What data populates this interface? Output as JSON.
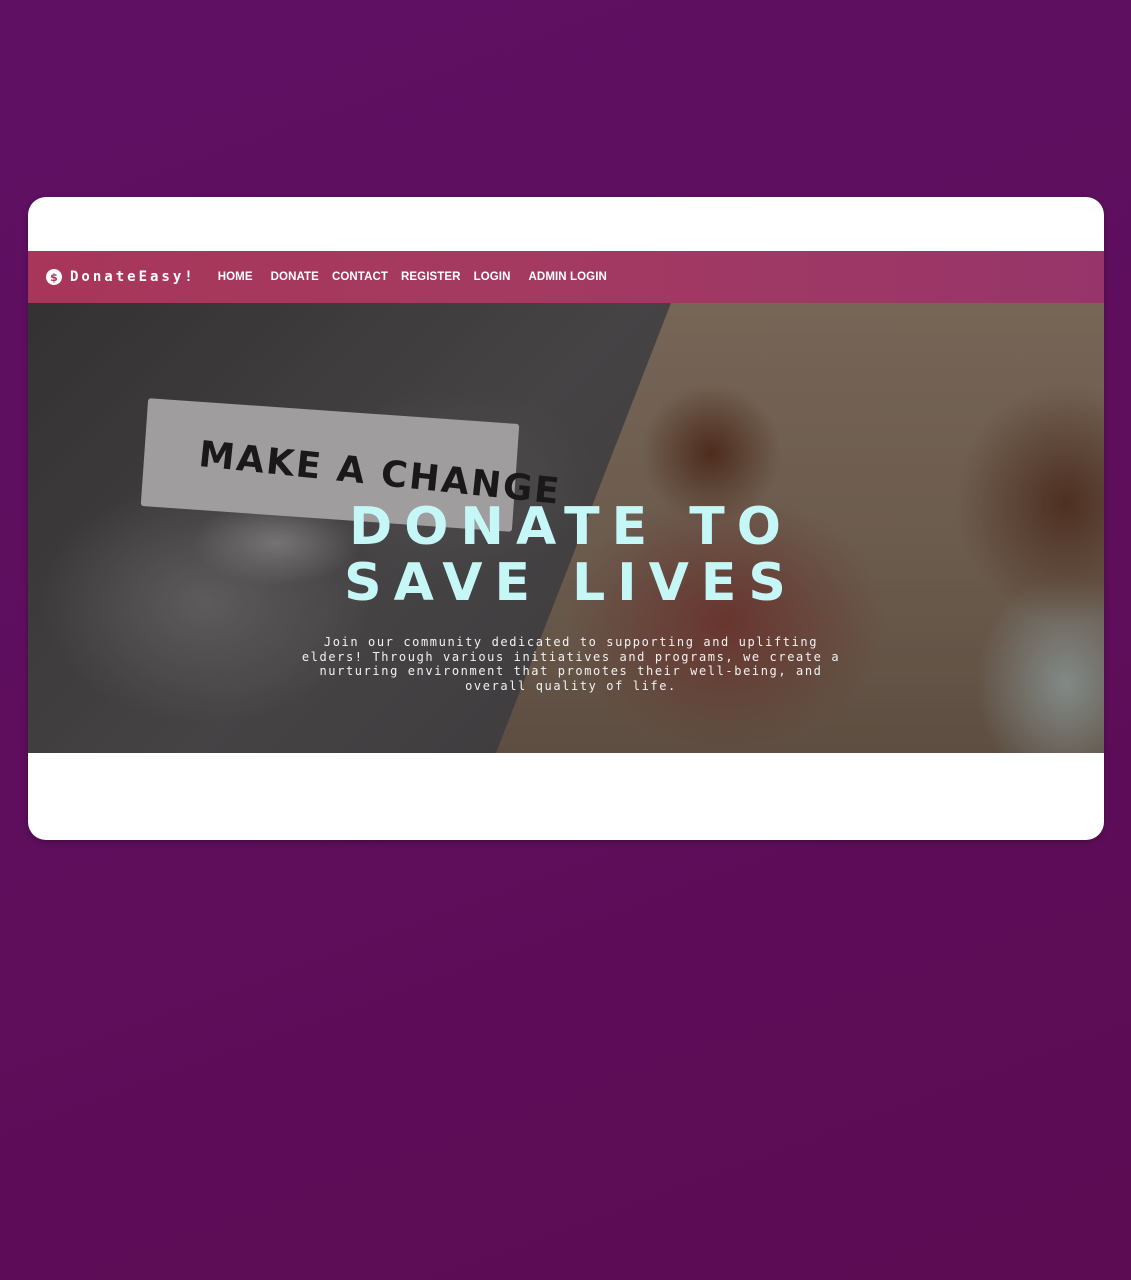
{
  "navbar": {
    "brand": {
      "icon": "dollar-icon",
      "icon_glyph": "$",
      "name": "DonateEasy!"
    },
    "links": {
      "home": "HOME",
      "donate": "DONATE",
      "contact": "CONTACT",
      "register": "REGISTER",
      "login": "LOGIN",
      "admin_login": "ADMIN LOGIN"
    },
    "color": "#a8365a"
  },
  "hero": {
    "image_text": "MAKE A CHANGE",
    "title_line1": "DONATE TO",
    "title_line2": "SAVE LIVES",
    "title_color": "#c6f7f7",
    "description": "Join our community dedicated to supporting and uplifting elders! Through various initiatives and programs, we create a nurturing environment that promotes their well-being, and overall quality of life."
  },
  "colors": {
    "background": "#5e0e5c",
    "card": "#ffffff"
  }
}
